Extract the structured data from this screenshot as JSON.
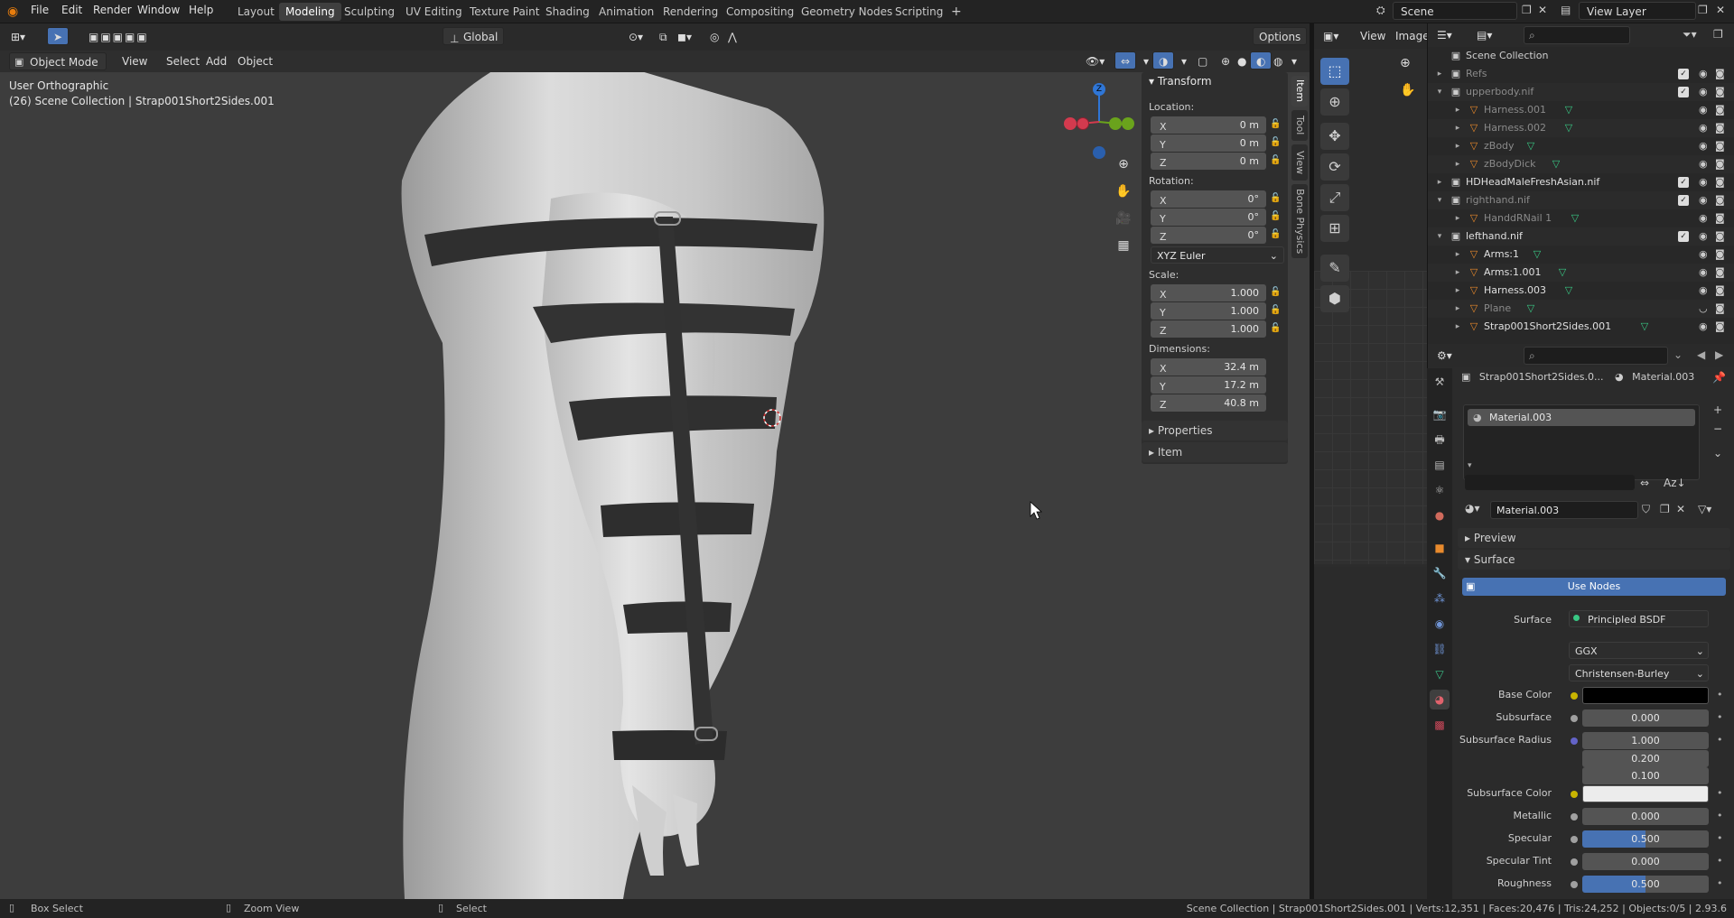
{
  "menus": [
    "File",
    "Edit",
    "Render",
    "Window",
    "Help"
  ],
  "workspaces": [
    "Layout",
    "Modeling",
    "Sculpting",
    "UV Editing",
    "Texture Paint",
    "Shading",
    "Animation",
    "Rendering",
    "Compositing",
    "Geometry Nodes",
    "Scripting"
  ],
  "active_workspace": "Modeling",
  "scene_field": "Scene",
  "view_layer_field": "View Layer",
  "viewport_header": {
    "mode": "Object Mode",
    "menus": [
      "View",
      "Select",
      "Add",
      "Object"
    ],
    "orientation": "Global",
    "options": "Options"
  },
  "viewport": {
    "view_name": "User Orthographic",
    "collection_info": "(26) Scene Collection | Strap001Short2Sides.001"
  },
  "npanel": {
    "transform_title": "Transform",
    "location_label": "Location:",
    "location": [
      {
        "axis": "X",
        "value": "0 m"
      },
      {
        "axis": "Y",
        "value": "0 m"
      },
      {
        "axis": "Z",
        "value": "0 m"
      }
    ],
    "rotation_label": "Rotation:",
    "rotation": [
      {
        "axis": "X",
        "value": "0°"
      },
      {
        "axis": "Y",
        "value": "0°"
      },
      {
        "axis": "Z",
        "value": "0°"
      }
    ],
    "rotation_mode": "XYZ Euler",
    "scale_label": "Scale:",
    "scale": [
      {
        "axis": "X",
        "value": "1.000"
      },
      {
        "axis": "Y",
        "value": "1.000"
      },
      {
        "axis": "Z",
        "value": "1.000"
      }
    ],
    "dimensions_label": "Dimensions:",
    "dimensions": [
      {
        "axis": "X",
        "value": "32.4 m"
      },
      {
        "axis": "Y",
        "value": "17.2 m"
      },
      {
        "axis": "Z",
        "value": "40.8 m"
      }
    ],
    "properties_title": "Properties",
    "item_title": "Item",
    "tabs": [
      "Item",
      "Tool",
      "View",
      "Bone Physics"
    ]
  },
  "image_editor_header": {
    "view": "View",
    "image": "Image"
  },
  "outliner": {
    "root": "Scene Collection",
    "rows": [
      {
        "name": "Refs",
        "indent": 1,
        "dim": true,
        "kind": "collection"
      },
      {
        "name": "upperbody.nif",
        "indent": 1,
        "dim": true,
        "kind": "collection"
      },
      {
        "name": "Harness.001",
        "indent": 2,
        "dim": true,
        "kind": "mesh"
      },
      {
        "name": "Harness.002",
        "indent": 2,
        "dim": true,
        "kind": "mesh"
      },
      {
        "name": "zBody",
        "indent": 2,
        "dim": true,
        "kind": "mesh"
      },
      {
        "name": "zBodyDick",
        "indent": 2,
        "dim": true,
        "kind": "mesh"
      },
      {
        "name": "HDHeadMaleFreshAsian.nif",
        "indent": 1,
        "dim": false,
        "kind": "collection"
      },
      {
        "name": "righthand.nif",
        "indent": 1,
        "dim": true,
        "kind": "collection"
      },
      {
        "name": "HanddRNail 1",
        "indent": 2,
        "dim": true,
        "kind": "mesh"
      },
      {
        "name": "lefthand.nif",
        "indent": 1,
        "dim": false,
        "kind": "collection"
      },
      {
        "name": "Arms:1",
        "indent": 2,
        "dim": false,
        "kind": "mesh"
      },
      {
        "name": "Arms:1.001",
        "indent": 2,
        "dim": false,
        "kind": "mesh"
      },
      {
        "name": "Harness.003",
        "indent": 2,
        "dim": false,
        "kind": "mesh"
      },
      {
        "name": "Plane",
        "indent": 2,
        "dim": true,
        "kind": "mesh"
      },
      {
        "name": "Strap001Short2Sides.001",
        "indent": 2,
        "dim": false,
        "kind": "mesh"
      }
    ]
  },
  "properties": {
    "object_name": "Strap001Short2Sides.0...",
    "material_tab": "Material.003",
    "slot": "Material.003",
    "material_field": "Material.003",
    "preview": "Preview",
    "surface_section": "Surface",
    "use_nodes": "Use Nodes",
    "surface_label": "Surface",
    "surface_value": "Principled BSDF",
    "distribution": "GGX",
    "subsurface_method": "Christensen-Burley",
    "rows": [
      {
        "label": "Base Color",
        "type": "color",
        "color": "#000000",
        "dot": "#c8b400"
      },
      {
        "label": "Subsurface",
        "value": "0.000",
        "dot": "#a0a0a0"
      },
      {
        "label": "Subsurface Radius",
        "value": "1.000",
        "dot": "#6363c7"
      },
      {
        "label": "",
        "value": "0.200"
      },
      {
        "label": "",
        "value": "0.100"
      },
      {
        "label": "Subsurface Color",
        "type": "color",
        "color": "#ececec",
        "dot": "#c8b400"
      },
      {
        "label": "Metallic",
        "value": "0.000",
        "dot": "#a0a0a0"
      },
      {
        "label": "Specular",
        "value": "0.500",
        "dot": "#a0a0a0",
        "bar": true
      },
      {
        "label": "Specular Tint",
        "value": "0.000",
        "dot": "#a0a0a0"
      },
      {
        "label": "Roughness",
        "value": "0.500",
        "dot": "#a0a0a0",
        "bar": true
      }
    ]
  },
  "status": {
    "left1": "Box Select",
    "left2": "Zoom View",
    "left3": "Select",
    "right": "Scene Collection | Strap001Short2Sides.001 | Verts:12,351 | Faces:20,476 | Tris:24,252 | Objects:0/5 | 2.93.6"
  },
  "colors": {
    "accent": "#4772b3",
    "axis_x": "#d33a4e",
    "axis_y": "#6aa31c",
    "axis_z": "#2f76d6"
  }
}
